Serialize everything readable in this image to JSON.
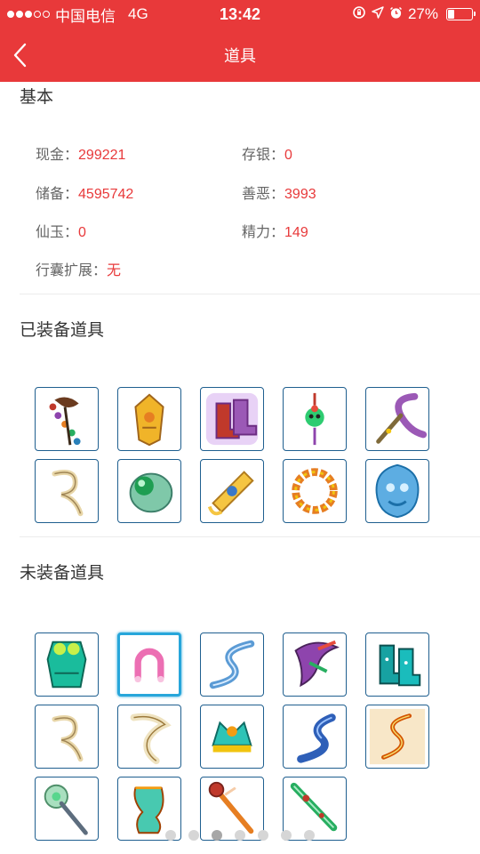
{
  "status_bar": {
    "signal_dots_filled": 3,
    "signal_dots_total": 5,
    "carrier": "中国电信",
    "network": "4G",
    "time": "13:42",
    "battery_text": "27%",
    "battery_level": 0.27,
    "icons": [
      "rotation-lock-icon",
      "location-arrow-icon",
      "alarm-icon",
      "battery-icon"
    ]
  },
  "nav": {
    "back_icon": "chevron-left-icon",
    "title": "道具"
  },
  "basic": {
    "title": "基本",
    "cash_label": "现金：",
    "cash_value": "299221",
    "deposit_label": "存银：",
    "deposit_value": "0",
    "reserve_label": "储备：",
    "reserve_value": "4595742",
    "karma_label": "善恶：",
    "karma_value": "3993",
    "jade_label": "仙玉：",
    "jade_value": "0",
    "energy_label": "精力：",
    "energy_value": "149",
    "bag_label": "行囊扩展：",
    "bag_value": "无"
  },
  "equipped": {
    "title": "已装备道具",
    "items": [
      {
        "icon": "flower-garland-weapon-icon"
      },
      {
        "icon": "golden-armor-icon"
      },
      {
        "icon": "purple-boots-icon"
      },
      {
        "icon": "skull-pendant-icon"
      },
      {
        "icon": "purple-ribbon-whip-icon"
      },
      {
        "icon": "bone-hook-icon"
      },
      {
        "icon": "jade-amulet-icon"
      },
      {
        "icon": "golden-fan-icon"
      },
      {
        "icon": "amber-bead-bracelet-icon"
      },
      {
        "icon": "blue-crystal-mask-icon"
      }
    ]
  },
  "unequipped": {
    "title": "未装备道具",
    "selected_index": 1,
    "items": [
      {
        "icon": "green-armor-icon"
      },
      {
        "icon": "pink-horseshoe-ring-icon"
      },
      {
        "icon": "blue-ribbon-icon"
      },
      {
        "icon": "dragon-claw-icon"
      },
      {
        "icon": "teal-boots-icon"
      },
      {
        "icon": "bone-hook-icon"
      },
      {
        "icon": "white-claw-icon"
      },
      {
        "icon": "jeweled-crown-icon"
      },
      {
        "icon": "blue-silk-ribbon-icon"
      },
      {
        "icon": "fire-serpent-whip-icon"
      },
      {
        "icon": "jade-scepter-icon"
      },
      {
        "icon": "enchanted-cloth-icon"
      },
      {
        "icon": "orange-staff-icon"
      },
      {
        "icon": "green-sword-icon"
      }
    ]
  },
  "pager": {
    "count": 7,
    "active_index": 2
  },
  "colors": {
    "brand_red": "#e8393a",
    "item_border": "#1f5f8f",
    "selected_border": "#27a6da"
  }
}
